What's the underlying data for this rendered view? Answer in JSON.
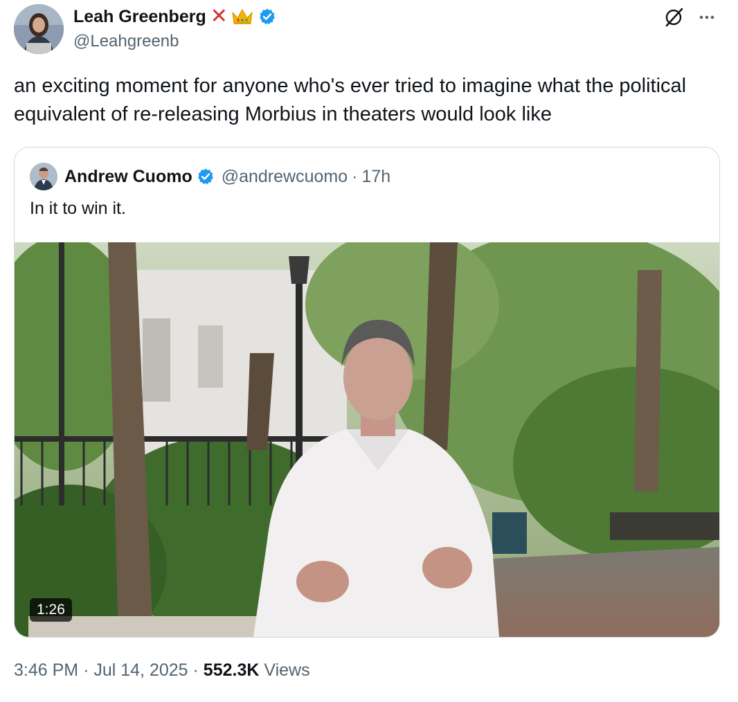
{
  "author": {
    "name": "Leah Greenberg",
    "handle": "@Leahgreenb",
    "emoji_badges": [
      "cross-mark-icon",
      "crown-icon"
    ],
    "verified": true
  },
  "tweet": {
    "text": "an exciting moment for anyone who's ever tried to imagine what the political equivalent of re-releasing Morbius in theaters would look like"
  },
  "quoted": {
    "name": "Andrew Cuomo",
    "handle": "@andrewcuomo",
    "separator": "·",
    "time": "17h",
    "text": "In it to win it.",
    "video_duration": "1:26"
  },
  "meta": {
    "time": "3:46 PM",
    "sep1": "·",
    "date": "Jul 14, 2025",
    "sep2": "·",
    "views_count": "552.3K",
    "views_label": "Views"
  },
  "colors": {
    "verified_blue": "#1d9bf0",
    "text_primary": "#0f1419",
    "text_secondary": "#536471",
    "border": "#cfd9de"
  }
}
